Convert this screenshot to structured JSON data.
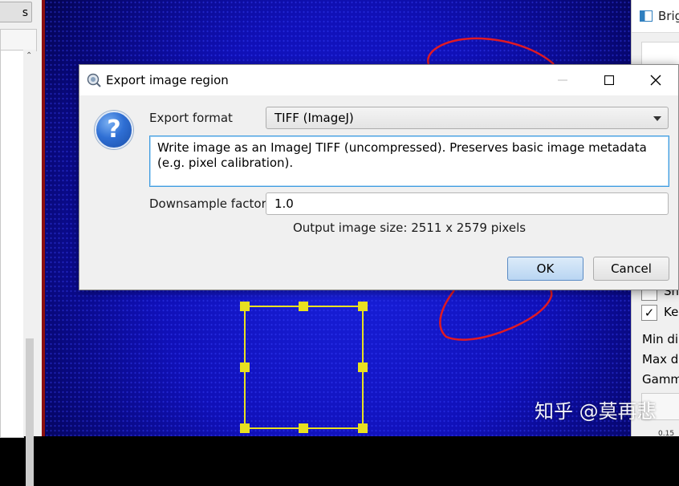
{
  "left_panel": {
    "button_label": "s"
  },
  "right_window": {
    "title": "Brig",
    "checkboxes": [
      {
        "label": "Sh",
        "checked": false
      },
      {
        "label": "Kee",
        "checked": true
      }
    ],
    "labels": [
      "Min di",
      "Max di",
      "Gamm"
    ],
    "value_text": "0.15"
  },
  "dialog": {
    "title": "Export image region",
    "export_format_label": "Export format",
    "export_format_value": "TIFF (ImageJ)",
    "description": "Write image as an ImageJ TIFF (uncompressed). Preserves basic image metadata (e.g. pixel calibration).",
    "downsample_label": "Downsample factor",
    "downsample_value": "1.0",
    "output_size_text": "Output image size: 2511 x 2579 pixels",
    "ok_label": "OK",
    "cancel_label": "Cancel"
  },
  "colors": {
    "annotation_red": "#e01a24",
    "selection_yellow": "#e8e020",
    "accent_blue": "#3c9be0"
  },
  "watermark": "知乎 @莫再悲"
}
